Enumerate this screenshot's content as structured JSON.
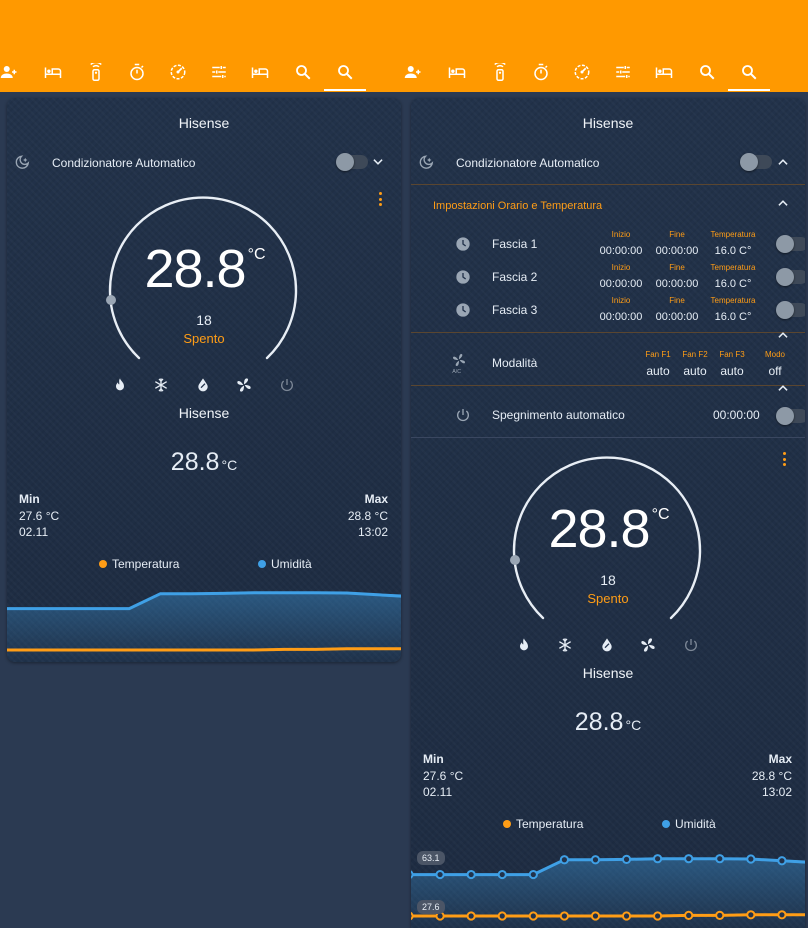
{
  "colors": {
    "header": "#ff9900",
    "accent": "#ff9d16",
    "temp_line": "#ff9d16",
    "humidity_line": "#3fa0e6",
    "card_bg": "#22324a",
    "page_bg": "#2b3a52"
  },
  "tabs": [
    {
      "icon": "person-icon"
    },
    {
      "icon": "bed-icon"
    },
    {
      "icon": "remote-icon"
    },
    {
      "icon": "timer-icon"
    },
    {
      "icon": "speed-icon"
    },
    {
      "icon": "tune-icon"
    },
    {
      "icon": "bed-icon"
    },
    {
      "icon": "search-icon"
    },
    {
      "icon": "search-icon",
      "active": true
    }
  ],
  "thermostat": {
    "name": "Hisense",
    "current_temp": "28.8",
    "unit": "°C",
    "target": "18",
    "state": "Spento",
    "dial_level": 0.02
  },
  "automation": {
    "label": "Condizionatore Automatico"
  },
  "schedule": {
    "header": "Impostazioni Orario e Temperatura",
    "col_start": "Inizio",
    "col_end": "Fine",
    "col_temp": "Temperatura",
    "rows": [
      {
        "name": "Fascia 1",
        "start": "00:00:00",
        "end": "00:00:00",
        "temp": "16.0 C°"
      },
      {
        "name": "Fascia 2",
        "start": "00:00:00",
        "end": "00:00:00",
        "temp": "16.0 C°"
      },
      {
        "name": "Fascia 3",
        "start": "00:00:00",
        "end": "00:00:00",
        "temp": "16.0 C°"
      }
    ]
  },
  "mode": {
    "label": "Modalità",
    "cols": [
      {
        "title": "Fan F1",
        "value": "auto"
      },
      {
        "title": "Fan F2",
        "value": "auto"
      },
      {
        "title": "Fan F3",
        "value": "auto"
      },
      {
        "title": "Modo",
        "value": "off"
      }
    ]
  },
  "auto_off": {
    "label": "Spegnimento automatico",
    "value": "00:00:00"
  },
  "sensor": {
    "name": "Hisense",
    "value": "28.8",
    "unit": "°C",
    "min_label": "Min",
    "min_value": "27.6 °C",
    "min_time": "02.11",
    "max_label": "Max",
    "max_value": "28.8 °C",
    "max_time": "13:02",
    "legend_temp": "Temperatura",
    "legend_hum": "Umidità"
  },
  "chart_data": {
    "type": "line",
    "title": "",
    "series": [
      {
        "name": "Temperatura",
        "values": [
          27.6,
          27.6,
          27.6,
          27.6,
          27.6,
          27.6,
          27.6,
          27.6,
          27.6,
          27.7,
          27.7,
          27.8,
          27.8,
          27.8
        ]
      },
      {
        "name": "Umidità",
        "values": [
          58.5,
          58.5,
          58.5,
          58.5,
          58.5,
          62.8,
          62.8,
          62.9,
          63.1,
          63.1,
          63.1,
          63.0,
          62.5,
          62.0
        ]
      }
    ],
    "labels_shown": {
      "humidity_first": "63.1",
      "temperature_first": "27.6"
    },
    "grid": false,
    "legend": "top"
  }
}
